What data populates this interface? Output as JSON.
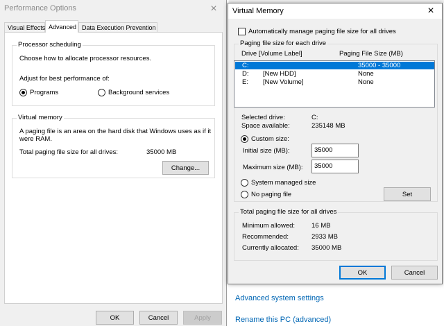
{
  "background": {
    "links": [
      "Advanced system settings",
      "Rename this PC (advanced)"
    ]
  },
  "perf_window": {
    "title": "Performance Options",
    "close_glyph": "×",
    "tabs": [
      "Visual Effects",
      "Advanced",
      "Data Execution Prevention"
    ],
    "active_tab": "Advanced",
    "processor": {
      "legend": "Processor scheduling",
      "description": "Choose how to allocate processor resources.",
      "adjust_label": "Adjust for best performance of:",
      "options": [
        "Programs",
        "Background services"
      ],
      "selected": "Programs"
    },
    "virtual_memory": {
      "legend": "Virtual memory",
      "description_line1": "A paging file is an area on the hard disk that Windows uses as if it",
      "description_line2": "were RAM.",
      "total_label": "Total paging file size for all drives:",
      "total_value": "35000 MB",
      "change_button": "Change..."
    },
    "buttons": {
      "ok": "OK",
      "cancel": "Cancel",
      "apply": "Apply"
    }
  },
  "vm_dialog": {
    "title": "Virtual Memory",
    "close_glyph": "×",
    "auto_manage_label": "Automatically manage paging file size for all drives",
    "auto_manage_checked": false,
    "each_drive": {
      "legend": "Paging file size for each drive",
      "columns": [
        "Drive  [Volume Label]",
        "Paging File Size (MB)"
      ],
      "drives": [
        {
          "drive": "C:",
          "label": "",
          "size": "35000 - 35000",
          "selected": true
        },
        {
          "drive": "D:",
          "label": "[New HDD]",
          "size": "None",
          "selected": false
        },
        {
          "drive": "E:",
          "label": "[New Volume]",
          "size": "None",
          "selected": false
        }
      ],
      "selected_drive_label": "Selected drive:",
      "selected_drive_value": "C:",
      "space_available_label": "Space available:",
      "space_available_value": "235148 MB",
      "custom_size_label": "Custom size:",
      "initial_size_label": "Initial size (MB):",
      "initial_size_value": "35000",
      "maximum_size_label": "Maximum size (MB):",
      "maximum_size_value": "35000",
      "system_managed_label": "System managed size",
      "no_paging_label": "No paging file",
      "size_mode": "Custom size",
      "set_button": "Set"
    },
    "totals": {
      "legend": "Total paging file size for all drives",
      "minimum_label": "Minimum allowed:",
      "minimum_value": "16 MB",
      "recommended_label": "Recommended:",
      "recommended_value": "2933 MB",
      "allocated_label": "Currently allocated:",
      "allocated_value": "35000 MB"
    },
    "buttons": {
      "ok": "OK",
      "cancel": "Cancel"
    }
  }
}
